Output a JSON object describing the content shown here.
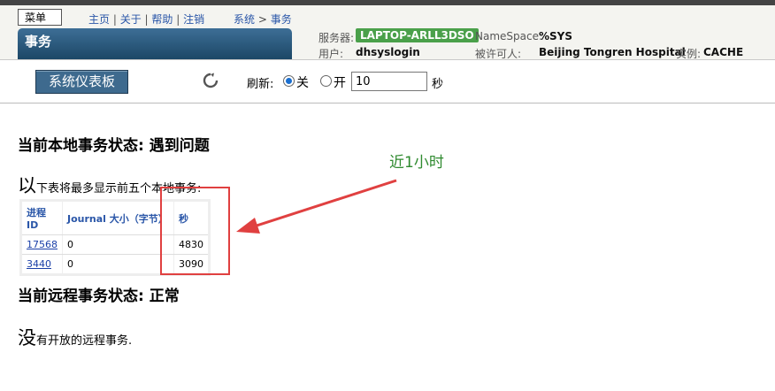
{
  "header": {
    "menu_label": "菜单",
    "nav": [
      "主页",
      "关于",
      "帮助",
      "注销"
    ],
    "breadcrumb": [
      "系统",
      "事务"
    ],
    "tab_title": "事务",
    "server_label": "服务器:",
    "server_value": "LAPTOP-ARLL3DSO",
    "namespace_label": "NameSpace:",
    "namespace_value": "%SYS",
    "user_label": "用户:",
    "user_value": "dhsyslogin",
    "licensee_label": "被许可人:",
    "licensee_value": "Beijing Tongren Hospital",
    "instance_label": "实例:",
    "instance_value": "CACHE",
    "server_badge_color": "#4aa04a"
  },
  "toolbar": {
    "dashboard_button": "系统仪表板",
    "refresh_label": "刷新:",
    "off_label": "关",
    "on_label": "开",
    "interval_value": "10",
    "seconds_unit": "秒",
    "refresh_off_selected": true
  },
  "local": {
    "heading": "当前本地事务状态: 遇到问题",
    "desc_first": "以",
    "desc_rest": "下表将最多显示前五个本地事务:",
    "columns": [
      "进程ID",
      "Journal 大小（字节）",
      "秒"
    ],
    "rows": [
      {
        "pid": "17568",
        "journal": "0",
        "seconds": "4830"
      },
      {
        "pid": "3440",
        "journal": "0",
        "seconds": "3090"
      }
    ]
  },
  "annotation": {
    "note": "近1小时",
    "color": "#e04040"
  },
  "remote": {
    "heading": "当前远程事务状态: 正常",
    "desc_first": "没",
    "desc_rest": "有开放的远程事务."
  }
}
